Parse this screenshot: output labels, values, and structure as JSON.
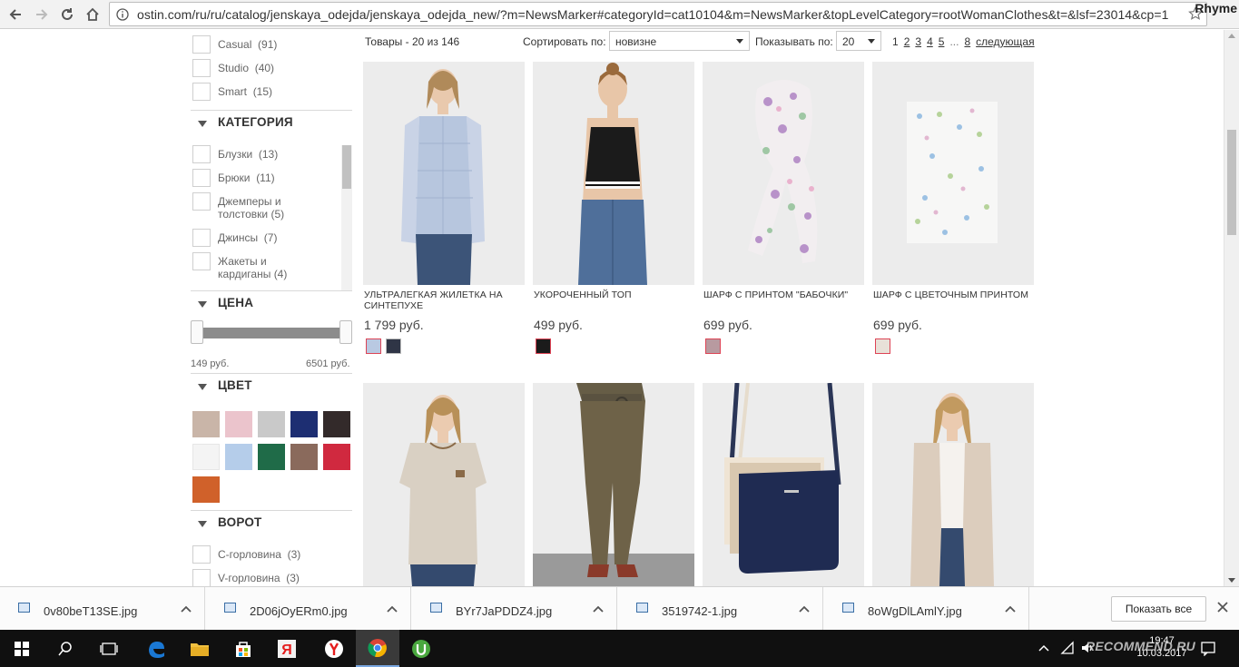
{
  "browser": {
    "url": "ostin.com/ru/ru/catalog/jenskaya_odejda/jenskaya_odejda_new/?m=NewsMarker#categoryId=cat10104&m=NewsMarker&topLevelCategory=rootWomanClothes&t=&lsf=23014&cp=1",
    "profile": "Rhyme"
  },
  "filters": {
    "style_items": [
      {
        "label": "Casual",
        "count": "(91)"
      },
      {
        "label": "Studio",
        "count": "(40)"
      },
      {
        "label": "Smart",
        "count": "(15)"
      }
    ],
    "category": {
      "title": "КАТЕГОРИЯ",
      "items": [
        {
          "label": "Блузки",
          "count": "(13)"
        },
        {
          "label": "Брюки",
          "count": "(11)"
        },
        {
          "label": "Джемперы и толстовки",
          "count": "(5)"
        },
        {
          "label": "Джинсы",
          "count": "(7)"
        },
        {
          "label": "Жакеты и кардиганы",
          "count": "(4)"
        }
      ]
    },
    "price": {
      "title": "ЦЕНА",
      "min": "149 руб.",
      "max": "6501 руб."
    },
    "color": {
      "title": "ЦВЕТ",
      "swatches": [
        "#c9b5a8",
        "#ebc4cc",
        "#c9c9c9",
        "#1d2e72",
        "#332a2a",
        "#f4f4f4",
        "#b5cdea",
        "#1f6b48",
        "#8a6a5c",
        "#d0293f",
        "#d0612a"
      ]
    },
    "collar": {
      "title": "ВОРОТ",
      "items": [
        {
          "label": "С-горловина",
          "count": "(3)"
        },
        {
          "label": "V-горловина",
          "count": "(3)"
        }
      ]
    }
  },
  "toolbar": {
    "count": "Товары - 20 из 146",
    "sort_label": "Сортировать по:",
    "sort_value": "новизне",
    "show_label": "Показывать по:",
    "show_value": "20",
    "pages": [
      "1",
      "2",
      "3",
      "4",
      "5",
      "...",
      "8"
    ],
    "next": "следующая"
  },
  "products": [
    {
      "name": "УЛЬТРАЛЕГКАЯ ЖИЛЕТКА НА СИНТЕПУХЕ",
      "price": "1 799 руб.",
      "colors": [
        "#b9c9e2",
        "#2f3546"
      ]
    },
    {
      "name": "УКОРОЧЕННЫЙ ТОП",
      "price": "499 руб.",
      "colors": [
        "#1b1b1b"
      ]
    },
    {
      "name": "ШАРФ С ПРИНТОМ \"БАБОЧКИ\"",
      "price": "699 руб.",
      "colors": [
        "#b89aa0"
      ]
    },
    {
      "name": "ШАРФ С ЦВЕТОЧНЫМ ПРИНТОМ",
      "price": "699 руб.",
      "colors": [
        "#e8e1d8"
      ]
    },
    {
      "name": "",
      "price": "",
      "colors": []
    },
    {
      "name": "",
      "price": "",
      "colors": []
    },
    {
      "name": "",
      "price": "",
      "colors": []
    },
    {
      "name": "",
      "price": "",
      "colors": []
    }
  ],
  "downloads": [
    {
      "file": "0v80beT13SE.jpg"
    },
    {
      "file": "2D06jOyERm0.jpg"
    },
    {
      "file": "BYr7JaPDDZ4.jpg"
    },
    {
      "file": "3519742-1.jpg"
    },
    {
      "file": "8oWgDlLAmlY.jpg"
    }
  ],
  "downloads_show_all": "Показать все",
  "taskbar": {
    "time": "19:47",
    "date": "10.03.2017",
    "watermark": "RECOMMEND.RU"
  }
}
